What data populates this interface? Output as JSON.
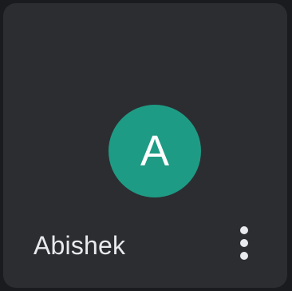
{
  "participant": {
    "name": "Abishek",
    "initial": "A",
    "avatar_color": "#1e9b84",
    "tile_color": "#2c2d31",
    "name_color": "#e8eaed"
  },
  "actions": {
    "more_icon": "more-vertical-icon"
  }
}
